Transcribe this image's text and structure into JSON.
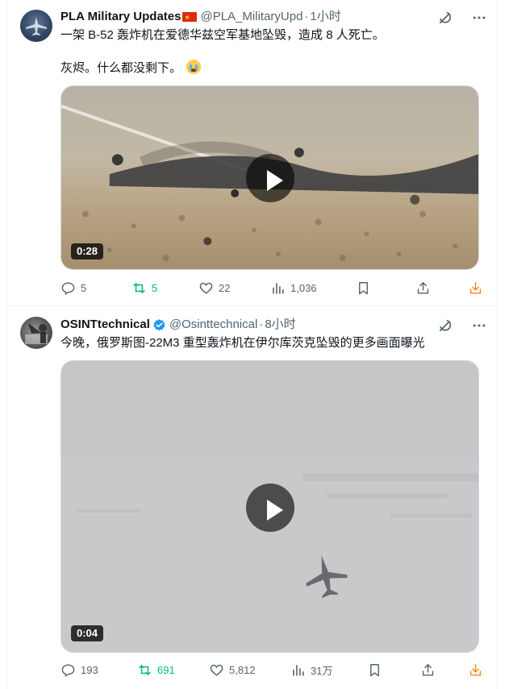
{
  "tweets": [
    {
      "author": "PLA Military Updates",
      "handle": "@PLA_MilitaryUpd",
      "separator": "·",
      "time": "1小时",
      "text_line1": "一架 B-52 轰炸机在爱德华兹空军基地坠毁，造成 8 人死亡。",
      "text_line2": "灰烬。什么都没剩下。",
      "video_duration": "0:28",
      "replies": "5",
      "reposts": "5",
      "likes": "22",
      "views": "1,036",
      "icons": {
        "grok": "grok-icon",
        "more": "more-icon",
        "flag": "china-flag-icon",
        "emoji": "crying-face-emoji"
      }
    },
    {
      "author": "OSINTtechnical",
      "handle": "@Osinttechnical",
      "separator": "·",
      "time": "8小时",
      "text_line1": "今晚，俄罗斯图-22M3 重型轰炸机在伊尔库茨克坠毁的更多画面曝光",
      "video_duration": "0:04",
      "replies": "193",
      "reposts": "691",
      "likes": "5,812",
      "views": "31万",
      "icons": {
        "verified": "verified-badge-icon"
      }
    }
  ],
  "colors": {
    "repost_active": "#00ba7c",
    "secondary_text": "#536471",
    "download": "#f7851d",
    "verified": "#1d9bf0"
  }
}
